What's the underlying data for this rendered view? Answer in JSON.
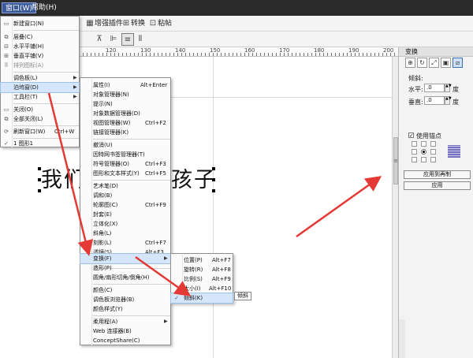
{
  "menubar": {
    "window": "窗口(W)",
    "help": "帮助(H)"
  },
  "toolbar": {
    "plugins": "增强插件",
    "convert": "转换",
    "paste": "粘帖"
  },
  "ruler_labels": [
    "120",
    "130",
    "140",
    "150",
    "160",
    "170",
    "180",
    "190",
    "200"
  ],
  "canvas": {
    "text_left": "我们",
    "text_right": "孩子"
  },
  "window_menu": [
    {
      "label": "新建窗口(N)",
      "icon": "new-window-icon"
    },
    {
      "label": "层叠(C)",
      "icon": "cascade-icon"
    },
    {
      "label": "水平平铺(H)",
      "icon": "tile-horizontal-icon"
    },
    {
      "label": "垂直平铺(V)",
      "icon": "tile-vertical-icon"
    },
    {
      "label": "排列图标(A)",
      "icon": "arrange-icons-icon",
      "dim": true
    },
    {
      "label": "调色板(L)",
      "submenu": true
    },
    {
      "label": "泊坞窗(D)",
      "submenu": true,
      "highlight": true
    },
    {
      "label": "工具栏(T)",
      "submenu": true
    },
    {
      "label": "关闭(O)",
      "icon": "close-window-icon"
    },
    {
      "label": "全部关闭(L)",
      "icon": "close-all-icon"
    },
    {
      "label": "刷新窗口(W)",
      "shortcut": "Ctrl+W",
      "icon": "refresh-icon"
    },
    {
      "label": "1 图形1",
      "checked": true
    }
  ],
  "docker_menu": [
    {
      "label": "属性(I)",
      "shortcut": "Alt+Enter"
    },
    {
      "label": "对象管理器(N)"
    },
    {
      "label": "提示(N)"
    },
    {
      "label": "对象数据管理器(D)"
    },
    {
      "label": "视图管理器(W)",
      "shortcut": "Ctrl+F2"
    },
    {
      "label": "链接管理器(K)"
    },
    {
      "label": "撤消(U)"
    },
    {
      "label": "因特网书签管理器(T)"
    },
    {
      "label": "符号管理器(O)",
      "shortcut": "Ctrl+F3"
    },
    {
      "label": "图形和文本样式(Y)",
      "shortcut": "Ctrl+F5"
    },
    {
      "label": "艺术笔(D)"
    },
    {
      "label": "调和(B)"
    },
    {
      "label": "轮廓图(C)",
      "shortcut": "Ctrl+F9"
    },
    {
      "label": "封套(E)"
    },
    {
      "label": "立体化(X)"
    },
    {
      "label": "斜角(L)"
    },
    {
      "label": "刻影(L)",
      "shortcut": "Ctrl+F7"
    },
    {
      "label": "透镜(S)",
      "shortcut": "Alt+F3"
    },
    {
      "label": "位图颜色遮罩(M)"
    },
    {
      "label": "变换(F)",
      "submenu": true,
      "highlight": true
    },
    {
      "label": "造形(P)"
    },
    {
      "label": "圆角/扇形切角/倒角(H)"
    },
    {
      "label": "颜色(C)"
    },
    {
      "label": "调色板浏览器(B)"
    },
    {
      "label": "颜色样式(Y)"
    },
    {
      "label": "柔用程(A)",
      "submenu": true
    },
    {
      "label": "Web 连接器(B)"
    },
    {
      "label": "ConceptShare(C)"
    }
  ],
  "transform_menu": [
    {
      "label": "位置(P)",
      "shortcut": "Alt+F7"
    },
    {
      "label": "旋转(R)",
      "shortcut": "Alt+F8"
    },
    {
      "label": "比例(S)",
      "shortcut": "Alt+F9"
    },
    {
      "label": "大小(I)",
      "shortcut": "Alt+F10"
    },
    {
      "label": "倾斜(K)",
      "checked": true,
      "highlight": true
    }
  ],
  "tooltip": "倾斜",
  "docker": {
    "title": "变换",
    "section": "倾斜:",
    "horizontal_label": "水平:",
    "horizontal_value": ".0",
    "vertical_label": "垂直:",
    "vertical_value": ".0",
    "unit": "度",
    "use_anchor_label": "使用锚点",
    "apply_copy": "应用到再制",
    "apply": "应用"
  },
  "colors": {
    "arrow": "#e53935",
    "menubar": "#2a2a2a",
    "highlight": "#d6e6fa"
  }
}
